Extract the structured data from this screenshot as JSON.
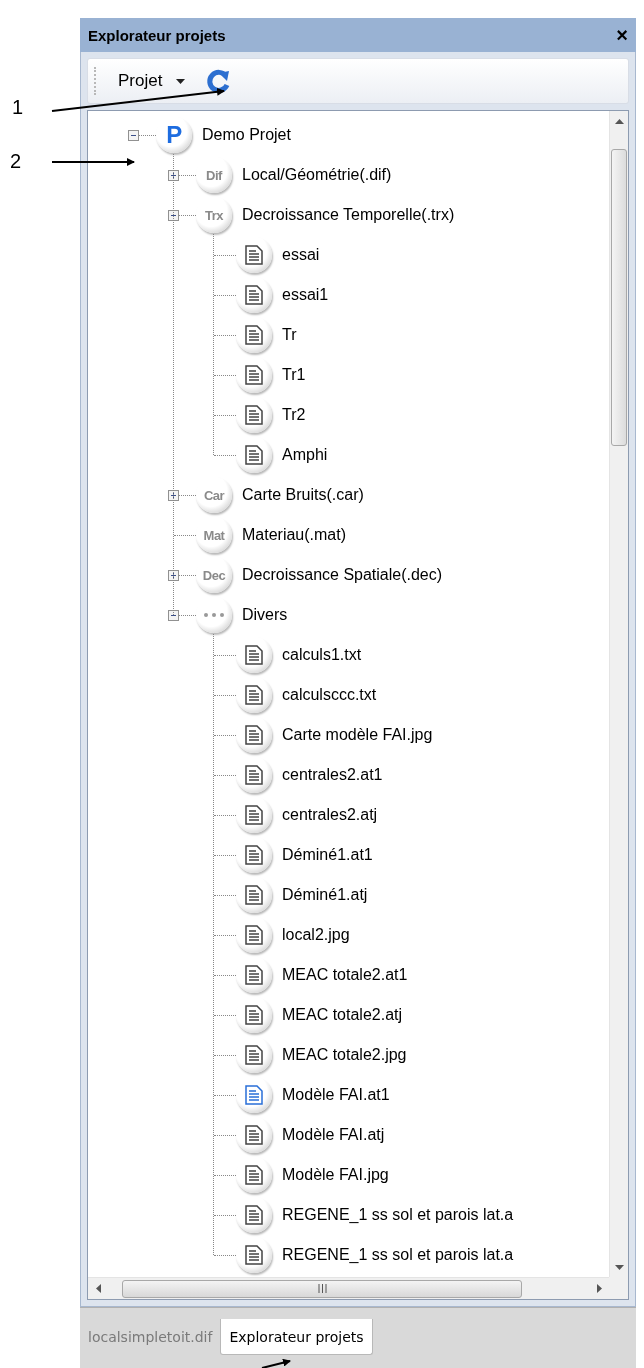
{
  "panel": {
    "title": "Explorateur projets",
    "close": "×"
  },
  "toolbar": {
    "menu": "Projet"
  },
  "tree": [
    {
      "kind": "project",
      "badge": "P",
      "label": "Demo Projet",
      "expanded": true,
      "children": [
        {
          "kind": "category",
          "badge": "Dif",
          "label": "Local/Géométrie(.dif)",
          "expanded": false
        },
        {
          "kind": "category",
          "badge": "Trx",
          "label": "Decroissance Temporelle(.trx)",
          "expanded": true,
          "children": [
            {
              "kind": "file",
              "label": "essai",
              "highlighted": false
            },
            {
              "kind": "file",
              "label": "essai1",
              "highlighted": false
            },
            {
              "kind": "file",
              "label": "Tr",
              "highlighted": false
            },
            {
              "kind": "file",
              "label": "Tr1",
              "highlighted": false
            },
            {
              "kind": "file",
              "label": "Tr2",
              "highlighted": false
            },
            {
              "kind": "file",
              "label": "Amphi",
              "highlighted": false
            }
          ]
        },
        {
          "kind": "category",
          "badge": "Car",
          "label": "Carte Bruits(.car)",
          "expanded": false
        },
        {
          "kind": "category",
          "badge": "Mat",
          "label": "Materiau(.mat)"
        },
        {
          "kind": "category",
          "badge": "Dec",
          "label": "Decroissance Spatiale(.dec)",
          "expanded": false
        },
        {
          "kind": "misc",
          "label": "Divers",
          "expanded": true,
          "children": [
            {
              "kind": "file",
              "label": "calculs1.txt",
              "highlighted": false
            },
            {
              "kind": "file",
              "label": "calculsccc.txt",
              "highlighted": false
            },
            {
              "kind": "file",
              "label": "Carte modèle FAI.jpg",
              "highlighted": false
            },
            {
              "kind": "file",
              "label": "centrales2.at1",
              "highlighted": false
            },
            {
              "kind": "file",
              "label": "centrales2.atj",
              "highlighted": false
            },
            {
              "kind": "file",
              "label": "Déminé1.at1",
              "highlighted": false
            },
            {
              "kind": "file",
              "label": "Déminé1.atj",
              "highlighted": false
            },
            {
              "kind": "file",
              "label": "local2.jpg",
              "highlighted": false
            },
            {
              "kind": "file",
              "label": "MEAC totale2.at1",
              "highlighted": false
            },
            {
              "kind": "file",
              "label": "MEAC totale2.atj",
              "highlighted": false
            },
            {
              "kind": "file",
              "label": "MEAC totale2.jpg",
              "highlighted": false
            },
            {
              "kind": "file",
              "label": "Modèle FAI.at1",
              "highlighted": true
            },
            {
              "kind": "file",
              "label": "Modèle FAI.atj",
              "highlighted": false
            },
            {
              "kind": "file",
              "label": "Modèle FAI.jpg",
              "highlighted": false
            },
            {
              "kind": "file",
              "label": "REGENE_1 ss sol et parois lat.a",
              "highlighted": false
            },
            {
              "kind": "file",
              "label": "REGENE_1 ss sol et parois lat.a",
              "highlighted": false
            }
          ]
        }
      ]
    }
  ],
  "tabs": [
    {
      "label": "localsimpletoit.dif",
      "selected": false
    },
    {
      "label": "Explorateur projets",
      "selected": true
    }
  ],
  "annotations": [
    {
      "kind": "numbered",
      "label": "1"
    },
    {
      "kind": "numbered",
      "label": "2"
    },
    {
      "kind": "arrow"
    }
  ]
}
